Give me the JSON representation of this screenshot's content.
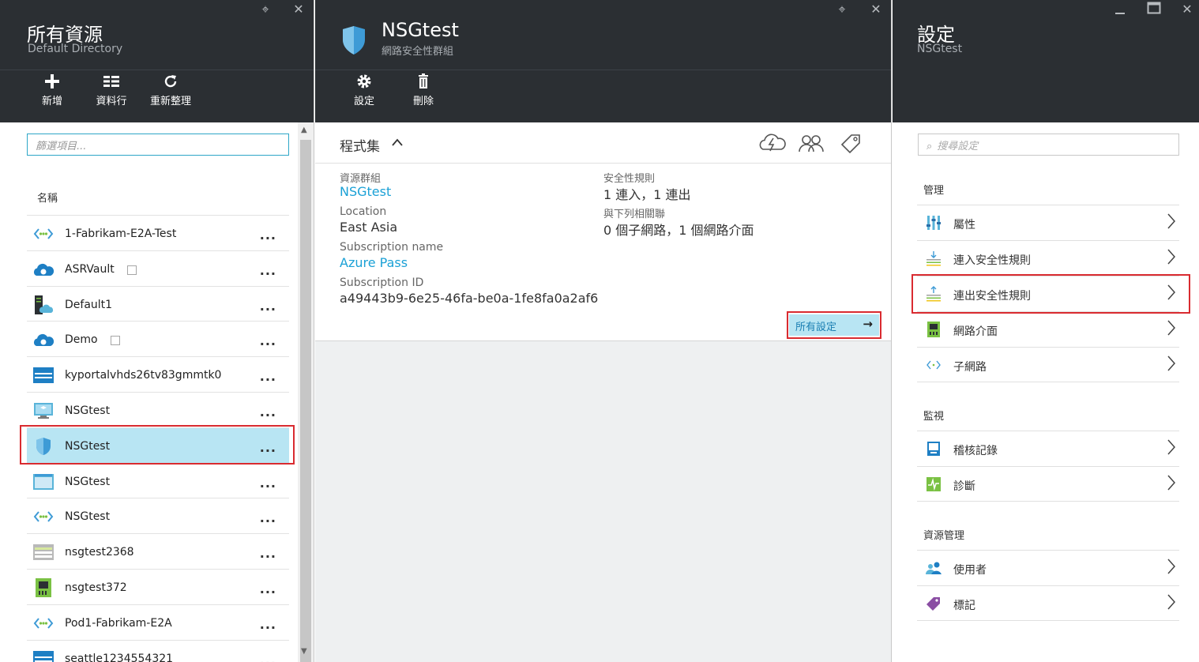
{
  "blade1": {
    "title": "所有資源",
    "subtitle": "Default Directory",
    "commands": [
      {
        "icon": "plus-icon",
        "label": "新增"
      },
      {
        "icon": "columns-icon",
        "label": "資料行"
      },
      {
        "icon": "refresh-icon",
        "label": "重新整理"
      }
    ],
    "filter_placeholder": "篩選項目...",
    "column_header": "名稱",
    "more_label": "...",
    "items": [
      {
        "name": "1-Fabrikam-E2A-Test",
        "icon": "virtual-network-icon"
      },
      {
        "name": "ASRVault",
        "icon": "cloud-vault-icon"
      },
      {
        "name": "Default1",
        "icon": "server-farm-icon"
      },
      {
        "name": "Demo",
        "icon": "cloud-vault-icon"
      },
      {
        "name": "kyportalvhds26tv83gmmtk0",
        "icon": "storage-account-icon"
      },
      {
        "name": "NSGtest",
        "icon": "virtual-machine-icon"
      },
      {
        "name": "NSGtest",
        "icon": "network-security-group-icon"
      },
      {
        "name": "NSGtest",
        "icon": "public-ip-icon"
      },
      {
        "name": "NSGtest",
        "icon": "virtual-network-icon"
      },
      {
        "name": "nsgtest2368",
        "icon": "storage-account-icon"
      },
      {
        "name": "nsgtest372",
        "icon": "network-interface-icon"
      },
      {
        "name": "Pod1-Fabrikam-E2A",
        "icon": "virtual-network-icon"
      },
      {
        "name": "seattle1234554321",
        "icon": "storage-account-icon"
      }
    ]
  },
  "blade2": {
    "title": "NSGtest",
    "subtitle": "網路安全性群組",
    "commands": [
      {
        "icon": "gear-icon",
        "label": "設定"
      },
      {
        "icon": "trash-icon",
        "label": "刪除"
      }
    ],
    "essentials_title": "程式集",
    "essentials_caret": "^",
    "left_fields": [
      {
        "label": "資源群組",
        "value": "NSGtest",
        "link": true
      },
      {
        "label": "Location",
        "value": "East Asia",
        "link": false
      },
      {
        "label": "Subscription name",
        "value": "Azure Pass",
        "link": true
      },
      {
        "label": "Subscription ID",
        "value": "a49443b9-6e25-46fa-be0a-1fe8fa0a2af6",
        "link": false
      }
    ],
    "right_fields": [
      {
        "label": "安全性規則",
        "value": "1 連入，1 連出"
      },
      {
        "label": "與下列相關聯",
        "value": "0 個子網路，1 個網路介面"
      }
    ],
    "all_settings_label": "所有設定"
  },
  "blade3": {
    "title": "設定",
    "subtitle": "NSGtest",
    "search_placeholder": "搜尋設定",
    "sections": [
      {
        "title": "管理",
        "items": [
          {
            "label": "屬性",
            "icon": "properties-icon"
          },
          {
            "label": "連入安全性規則",
            "icon": "inbound-rules-icon"
          },
          {
            "label": "連出安全性規則",
            "icon": "outbound-rules-icon"
          },
          {
            "label": "網路介面",
            "icon": "network-interface-icon"
          },
          {
            "label": "子網路",
            "icon": "subnet-icon"
          }
        ]
      },
      {
        "title": "監視",
        "items": [
          {
            "label": "稽核記錄",
            "icon": "audit-log-icon"
          },
          {
            "label": "診斷",
            "icon": "diagnostics-icon"
          }
        ]
      },
      {
        "title": "資源管理",
        "items": [
          {
            "label": "使用者",
            "icon": "users-icon"
          },
          {
            "label": "標記",
            "icon": "tag-icon"
          }
        ]
      }
    ]
  },
  "colors": {
    "header_bg": "#2b2f33",
    "link": "#1ba1d6",
    "selection": "#b8e5f3",
    "highlight_border": "#d92b30"
  }
}
